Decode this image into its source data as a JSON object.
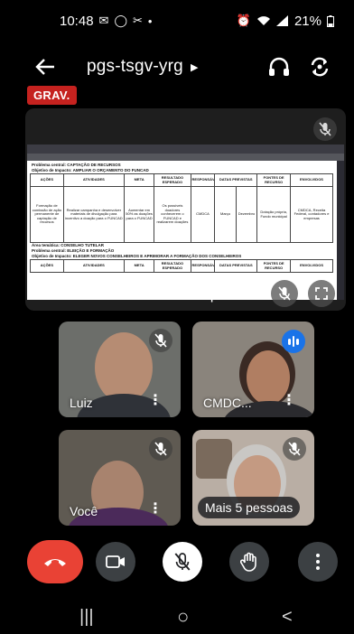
{
  "status_bar": {
    "time": "10:48",
    "notification_icons": [
      "mail-icon",
      "whatsapp-icon",
      "tools-icon",
      "dot-icon"
    ],
    "system_icons": [
      "alarm-icon",
      "wifi-icon",
      "signal-icon"
    ],
    "battery": "21%"
  },
  "top_bar": {
    "title": "pgs-tsgv-yrg"
  },
  "recording_badge": "GRAV.",
  "presentation": {
    "caption": "CMDCA - Secretaria está apre...",
    "document": {
      "line1": "Problema central: CAPTAÇÃO DE RECURSOS",
      "line2": "Objetivo de Impacto: AMPLIAR O ORÇAMENTO DO FUNCAD",
      "headers": [
        "AÇÕES",
        "ATIVIDADES",
        "META",
        "RESULTADO ESPERADO",
        "RESPONSÁVEL",
        "DATAS PREVISTAS",
        "FONTES DE RECURSO",
        "ENVOLVIDOS"
      ],
      "row": [
        "Formação de comissão de ação permanente de captação de recursos",
        "Realizar campanha e desenvolver materiais de divulgação para incentivo a doação para o FUNCAD",
        "Aumentar em 50% as doações para o FUNCAD",
        "Os possíveis doadores conhecerem o FUNCAD e realizarem doações",
        "CMDCA",
        "Março",
        "Dezembro",
        "Dotação própria, Fundo municipal",
        "CMDCA, Receita Federal, contadores e empresas"
      ],
      "line3": "Área temática: CONSELHO TUTELAR",
      "line4": "Problema central: ELEIÇÃO E FORMAÇÃO",
      "line5": "Objetivo de Impacto: ELEGER NOVOS CONSELHEIROS E APRIMORAR A FORMAÇÃO DOS CONSELHEIROS"
    }
  },
  "participants": [
    {
      "name": "Luiz"
    },
    {
      "name": "CMDC..."
    },
    {
      "name": "Você"
    },
    {
      "name": "Mais 5 pessoas"
    }
  ],
  "colors": {
    "end_call": "#e94235",
    "record": "#c5221f",
    "speaking": "#1a73e8",
    "control_gray": "#3c4043"
  },
  "nav_bar": {
    "recents": "|||",
    "home": "○",
    "back": "<"
  }
}
